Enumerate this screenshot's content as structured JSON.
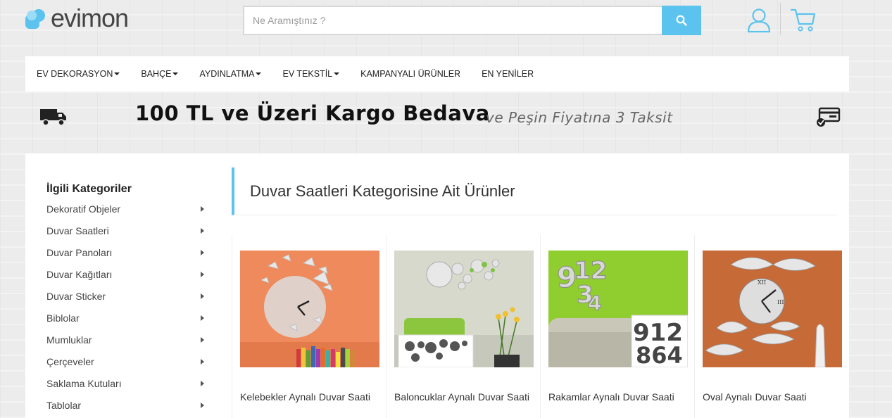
{
  "brand": {
    "logo_text_1": "evim",
    "logo_text_2": "on"
  },
  "search": {
    "placeholder": "Ne Aramıştınız ?"
  },
  "nav": {
    "items": [
      {
        "label": "EV DEKORASYON",
        "has_dropdown": true
      },
      {
        "label": "BAHÇE",
        "has_dropdown": true
      },
      {
        "label": "AYDINLATMA",
        "has_dropdown": true
      },
      {
        "label": "EV TEKSTİL",
        "has_dropdown": true
      },
      {
        "label": "KAMPANYALI ÜRÜNLER",
        "has_dropdown": false
      },
      {
        "label": "EN YENİLER",
        "has_dropdown": false
      }
    ]
  },
  "promo": {
    "main": "100 TL ve Üzeri Kargo Bedava",
    "sub": "ve Peşin Fiyatına 3 Taksit"
  },
  "sidebar": {
    "title": "İlgili Kategoriler",
    "items": [
      "Dekoratif Objeler",
      "Duvar Saatleri",
      "Duvar Panoları",
      "Duvar Kağıtları",
      "Duvar Sticker",
      "Biblolar",
      "Mumluklar",
      "Çerçeveler",
      "Saklama Kutuları",
      "Tablolar"
    ]
  },
  "main": {
    "title": "Duvar Saatleri Kategorisine Ait Ürünler"
  },
  "products": [
    {
      "name": "Kelebekler Aynalı Duvar Saati"
    },
    {
      "name": "Baloncuklar Aynalı Duvar Saati"
    },
    {
      "name": "Rakamlar Aynalı Duvar Saati"
    },
    {
      "name": "Oval Aynalı Duvar Saati"
    }
  ],
  "colors": {
    "accent": "#5cc3ee",
    "text": "#333333"
  },
  "icons": [
    "search-icon",
    "user-icon",
    "cart-icon",
    "truck-icon",
    "credit-card-icon",
    "chevron-right-icon"
  ]
}
